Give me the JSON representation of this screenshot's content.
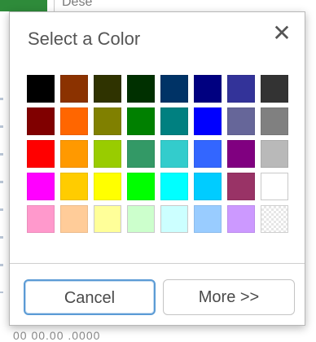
{
  "background": {
    "top_text": "Dese",
    "bottom_text": "00 00.00  .0000"
  },
  "dialog": {
    "title": "Select a Color",
    "close_icon": "close-icon",
    "close_glyph": "✕",
    "swatches": [
      [
        "#000000",
        "#8b3200",
        "#2f3300",
        "#003000",
        "#003366",
        "#000080",
        "#333399",
        "#333333"
      ],
      [
        "#800000",
        "#ff6600",
        "#808000",
        "#008000",
        "#008080",
        "#0000ff",
        "#666699",
        "#808080"
      ],
      [
        "#ff0000",
        "#ff9900",
        "#99cc00",
        "#339966",
        "#33cccc",
        "#3366ff",
        "#800080",
        "#b9b9b9"
      ],
      [
        "#ff00ff",
        "#ffcc00",
        "#ffff00",
        "#00ff00",
        "#00ffff",
        "#00ccff",
        "#993366",
        "#ffffff"
      ],
      [
        "#ff99cc",
        "#ffcc99",
        "#ffff99",
        "#ccffcc",
        "#ccffff",
        "#99ccff",
        "#cc99ff",
        "transparent"
      ]
    ],
    "buttons": {
      "cancel_label": "Cancel",
      "more_label": "More >>"
    }
  }
}
